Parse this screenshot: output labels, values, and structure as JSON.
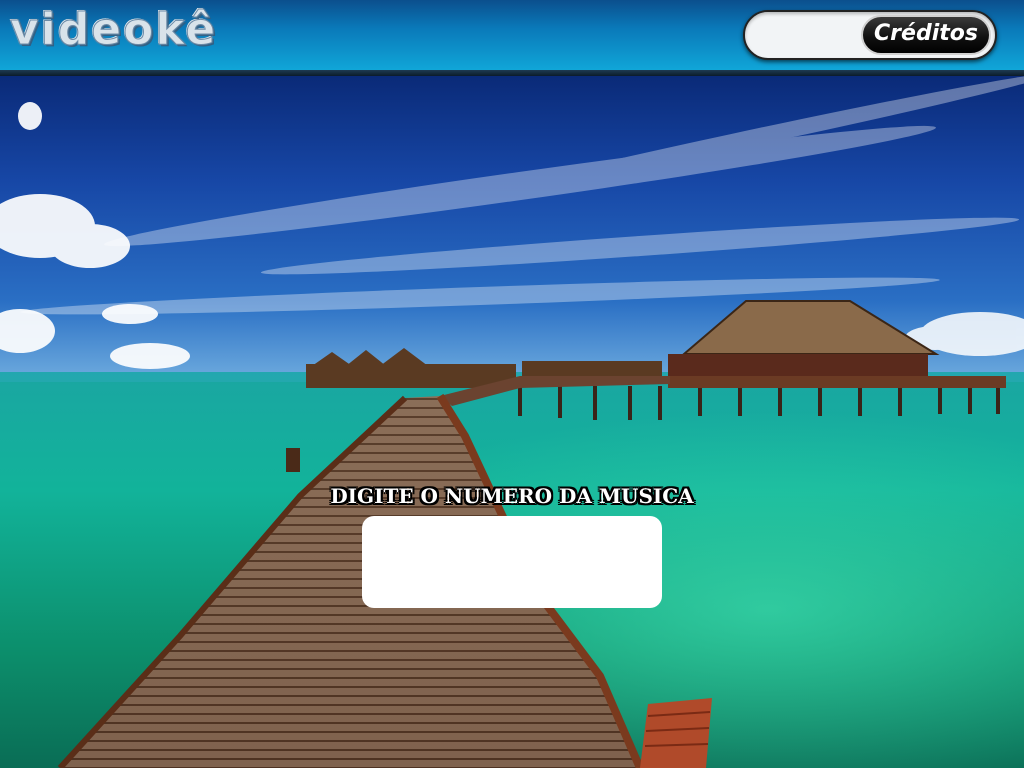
{
  "header": {
    "logo_text": "videokê",
    "credits_button_label": "Créditos",
    "credits_value": ""
  },
  "main": {
    "prompt_label": "DIGITE O NUMERO DA MUSICA",
    "song_number_value": ""
  },
  "colors": {
    "header_top": "#0b4f8d",
    "header_bottom": "#10a6d8",
    "button_bg": "#111111",
    "input_bg": "#ffffff"
  },
  "icons": {
    "background": "tropical-pier-photo"
  }
}
